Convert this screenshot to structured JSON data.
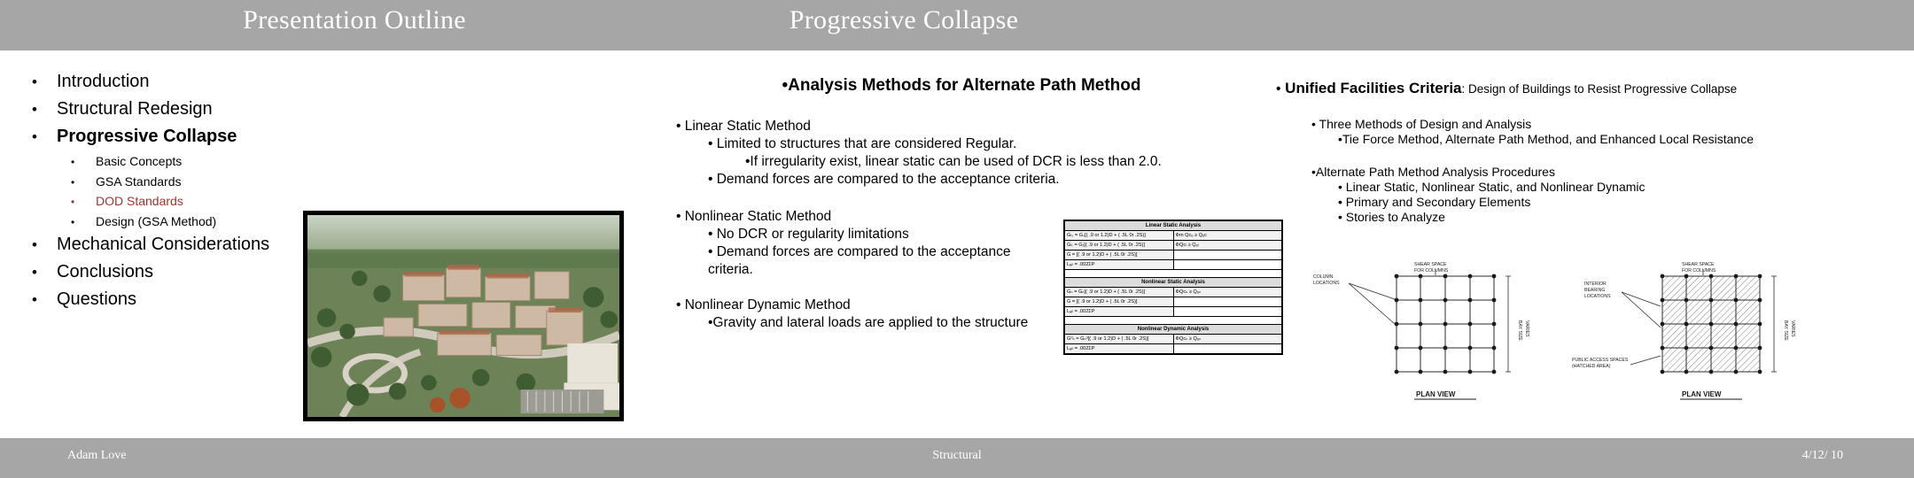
{
  "titlebar": {
    "left_title": "Presentation Outline",
    "right_title": "Progressive Collapse",
    "background_color": "#a6a6a6",
    "text_color": "#ffffff"
  },
  "outline": {
    "bullet_glyph": "•",
    "highlight_color": "#963634",
    "items": [
      {
        "label": "Introduction",
        "level": 1,
        "bold": false,
        "highlight": false
      },
      {
        "label": "Structural Redesign",
        "level": 1,
        "bold": false,
        "highlight": false
      },
      {
        "label": "Progressive Collapse",
        "level": 1,
        "bold": true,
        "highlight": false
      },
      {
        "label": "Basic Concepts",
        "level": 2,
        "bold": false,
        "highlight": false
      },
      {
        "label": "GSA Standards",
        "level": 2,
        "bold": false,
        "highlight": false
      },
      {
        "label": "DOD Standards",
        "level": 2,
        "bold": false,
        "highlight": true
      },
      {
        "label": "Design (GSA Method)",
        "level": 2,
        "bold": false,
        "highlight": false
      },
      {
        "label": "Mechanical Considerations",
        "level": 1,
        "bold": false,
        "highlight": false
      },
      {
        "label": "Conclusions",
        "level": 1,
        "bold": false,
        "highlight": false
      },
      {
        "label": "Questions",
        "level": 1,
        "bold": false,
        "highlight": false
      }
    ]
  },
  "photo": {
    "caption": "aerial-campus-photograph"
  },
  "middle": {
    "heading": "•Analysis Methods for Alternate Path Method",
    "blocks": [
      {
        "level": 1,
        "text": "• Linear Static Method"
      },
      {
        "level": 2,
        "text": "• Limited to structures that are considered Regular."
      },
      {
        "level": 3,
        "text": "•If irregularity exist, linear static can be used of DCR is less than 2.0."
      },
      {
        "level": 2,
        "text": "• Demand forces are compared to the acceptance criteria."
      },
      {
        "level": 0,
        "text": ""
      },
      {
        "level": 1,
        "text": "• Nonlinear Static Method"
      },
      {
        "level": 2,
        "text": "• No DCR or regularity limitations"
      },
      {
        "level": 2,
        "text": "• Demand forces are compared to the acceptance"
      },
      {
        "level": 2,
        "text": "criteria."
      },
      {
        "level": 0,
        "text": ""
      },
      {
        "level": 1,
        "text": "• Nonlinear Dynamic Method"
      },
      {
        "level": 2,
        "text": "•Gravity and lateral loads are applied to the structure"
      }
    ]
  },
  "eqtable": {
    "sections": [
      {
        "header": "Linear Static Analysis",
        "rows": [
          {
            "c1": "Gₗₛ = Gₛ[( .9 or 1.2)D + ( .5L 0r .2S)]",
            "c2": "Φm Qᴄₑ ≥ Qᵤᴄ"
          },
          {
            "c1": "Gₗₜ = Gₜ[( .9 or 1.2)D + ( .5L 0r .2S)]",
            "c2": "ΦQᴄₗ ≥ Qᵤₗ"
          },
          {
            "c1": "G = [( .9 or 1.2)D + ( .5L 0r .2S)]",
            "c2": ""
          },
          {
            "c1": "Lₐₗₗ = .002ΣP",
            "c2": ""
          }
        ]
      },
      {
        "header": "Nonlinear Static Analysis",
        "rows": [
          {
            "c1": "Gₙ = Gₙ[( .9 or 1.2)D + ( .5L 0r .2S)]",
            "c2": "ΦQᴄₙ ≥ Qᵤₙ"
          },
          {
            "c1": "G = [( .9 or 1.2)D + ( .5L 0r .2S)]",
            "c2": ""
          },
          {
            "c1": "Lₐₗₗ = .002ΣP",
            "c2": ""
          }
        ]
      },
      {
        "header": "Nonlinear Dynamic Analysis",
        "rows": [
          {
            "c1": "Gᵈₙ = Gₙᵈ[( .9 or 1.2)D + ( .5L 0r .2S)]",
            "c2": "ΦQᴄₙ ≥ Qᵤₙ"
          },
          {
            "c1": "Lₐₗₗ = .002ΣP",
            "c2": ""
          }
        ]
      }
    ]
  },
  "right": {
    "heading_bullet": "•",
    "heading_bold": " Unified Facilities Criteria",
    "heading_rest": ": Design of Buildings to Resist Progressive Collapse",
    "blocks": [
      {
        "level": 1,
        "text": "• Three Methods of Design and Analysis"
      },
      {
        "level": 2,
        "text": "•Tie Force Method, Alternate Path Method, and Enhanced Local Resistance"
      },
      {
        "level": 0,
        "text": ""
      },
      {
        "level": 1,
        "text": "•Alternate Path Method Analysis Procedures"
      },
      {
        "level": 2,
        "text": "• Linear Static, Nonlinear Static, and Nonlinear Dynamic"
      },
      {
        "level": 2,
        "text": "• Primary and Secondary Elements"
      },
      {
        "level": 2,
        "text": "• Stories to Analyze"
      }
    ]
  },
  "diagrams": {
    "left": {
      "name": "plan-view-column-removal-diagram",
      "labels": [
        "COLUMN\nLOCATIONS",
        "SHEAR SPACE\nFOR COLUMNS",
        "PLAN  VIEW",
        "BAY SIZE\nVARIES"
      ]
    },
    "right": {
      "name": "plan-view-public-access-diagram",
      "labels": [
        "SHEAR SPACE\nFOR COLUMNS",
        "INTERIOR\nBEARING\nLOCATIONS",
        "PUBLIC ACCESS SPACES\n(HATCHED AREA)",
        "PLAN  VIEW",
        "BAY SIZE\nVARIES"
      ]
    }
  },
  "footer": {
    "author": "Adam Love",
    "section": "Structural",
    "date": "4/12/ 10",
    "background_color": "#a6a6a6",
    "text_color": "#ffffff"
  }
}
